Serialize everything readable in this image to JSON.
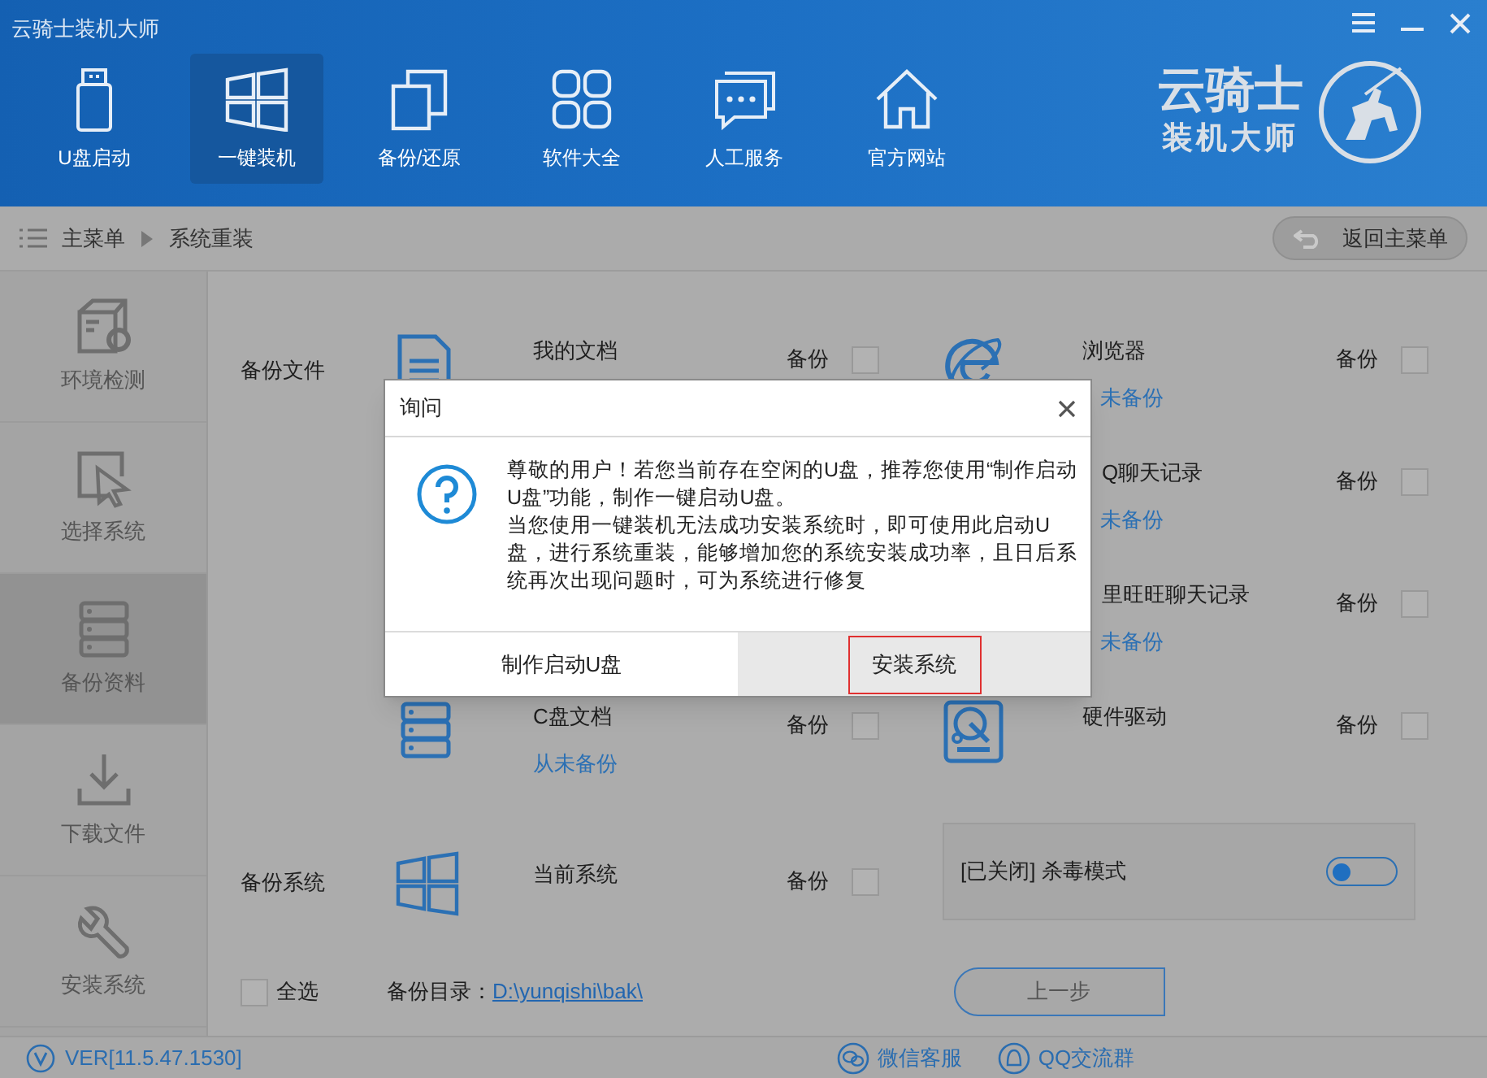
{
  "window": {
    "title": "云骑士装机大师"
  },
  "nav": [
    {
      "label": "U盘启动",
      "kind": "usb",
      "selected": false
    },
    {
      "label": "一键装机",
      "kind": "windows",
      "selected": true
    },
    {
      "label": "备份/还原",
      "kind": "copy",
      "selected": false
    },
    {
      "label": "软件大全",
      "kind": "grid",
      "selected": false
    },
    {
      "label": "人工服务",
      "kind": "chat",
      "selected": false
    },
    {
      "label": "官方网站",
      "kind": "home",
      "selected": false
    }
  ],
  "logo": {
    "line_1": "云骑士",
    "line_2": "装机大师"
  },
  "breadcrumb": {
    "items": [
      "主菜单",
      "系统重装"
    ],
    "back_button": "返回主菜单"
  },
  "sidebar": [
    {
      "label": "环境检测",
      "kind": "box-gear",
      "selected": false
    },
    {
      "label": "选择系统",
      "kind": "cursor",
      "selected": false
    },
    {
      "label": "备份资料",
      "kind": "server",
      "selected": true
    },
    {
      "label": "下载文件",
      "kind": "download",
      "selected": false
    },
    {
      "label": "安装系统",
      "kind": "wrench",
      "selected": false
    }
  ],
  "backup_files": {
    "label": "备份文件",
    "rows": [
      {
        "left": {
          "kind": "document",
          "name": "我的文档",
          "backup_label": "备份",
          "checked": false
        },
        "right": {
          "kind": "browser",
          "name": "浏览器",
          "status": "未备份",
          "backup_label": "备份",
          "checked": false
        }
      },
      {
        "right": {
          "name": "Q聊天记录",
          "status": "未备份",
          "backup_label": "备份",
          "checked": false
        }
      },
      {
        "right": {
          "name": "里旺旺聊天记录",
          "status": "未备份",
          "backup_label": "备份",
          "checked": false
        }
      },
      {
        "left": {
          "kind": "server",
          "name": "C盘文档",
          "status": "从未备份",
          "backup_label": "备份",
          "checked": false
        },
        "right": {
          "kind": "disk",
          "name": "硬件驱动",
          "backup_label": "备份",
          "checked": false
        }
      }
    ]
  },
  "backup_system": {
    "label": "备份系统",
    "item": {
      "name": "当前系统",
      "backup_label": "备份",
      "checked": false
    },
    "antivirus": {
      "label": "[已关闭] 杀毒模式",
      "on": false
    }
  },
  "select_all": {
    "label": "全选",
    "checked": false
  },
  "backup_dir": {
    "label": "备份目录：",
    "path": "D:\\yunqishi\\bak\\"
  },
  "prev_button": "上一步",
  "footer": {
    "version": "VER[11.5.47.1530]",
    "links": [
      {
        "label": "微信客服",
        "kind": "wechat"
      },
      {
        "label": "QQ交流群",
        "kind": "qq"
      }
    ]
  },
  "dialog": {
    "title": "询问",
    "message": [
      "尊敬的用户！若您当前存在空闲的U盘，推荐您使用“制作启动U盘”功能，制作一键启动U盘。",
      "当您使用一键装机无法成功安装系统时，即可使用此启动U盘，进行系统重装，能够增加您的系统安装成功率，且日后系统再次出现问题时，可为系统进行修复"
    ],
    "buttons": [
      {
        "label": "制作启动U盘",
        "focused": false
      },
      {
        "label": "安装系统",
        "focused": true
      }
    ]
  }
}
